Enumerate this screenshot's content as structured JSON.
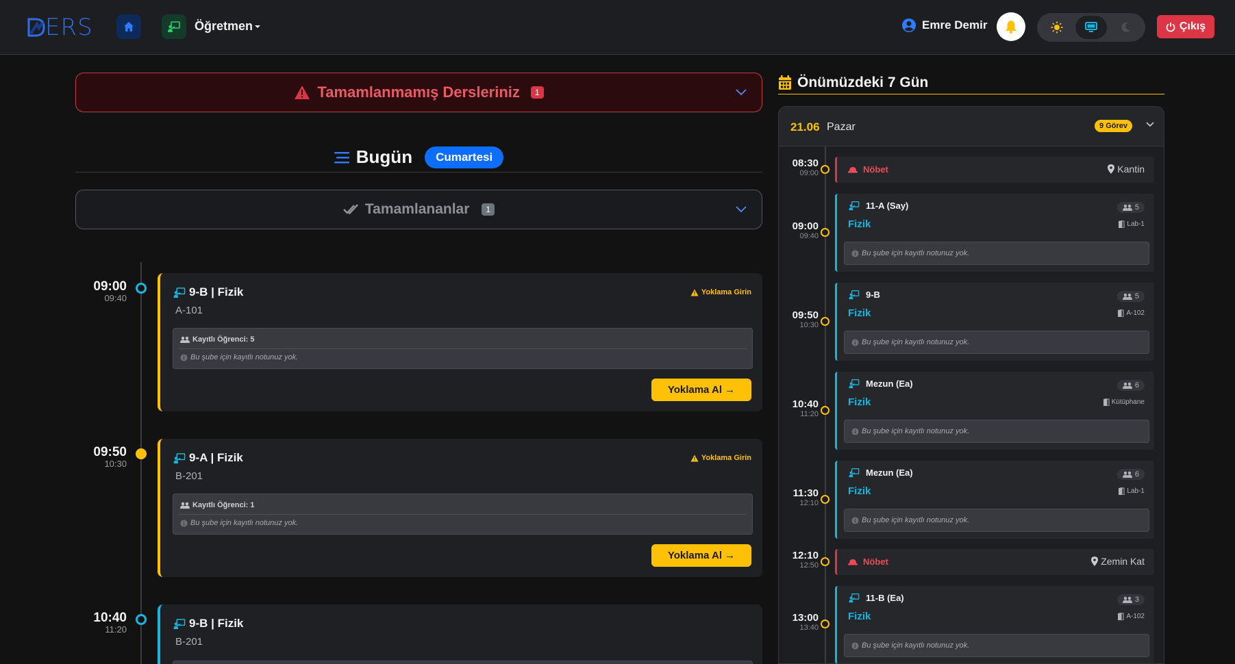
{
  "navbar": {
    "logo_text": "ERS",
    "role_label": "Öğretmen",
    "user_name": "Emre Demir",
    "logout_label": "Çıkış",
    "colors": {
      "bg": "#1d1e21",
      "brand": "#2e6ee6",
      "danger": "#dc3545"
    },
    "icons": [
      "home-icon",
      "teacher-icon",
      "user-circle-icon",
      "bell-icon",
      "sun-icon",
      "monitor-icon",
      "moon-icon",
      "power-icon"
    ]
  },
  "incomplete": {
    "title": "Tamamlanmamış Dersleriniz",
    "count": "1"
  },
  "today": {
    "title": "Bugün",
    "day": "Cumartesi"
  },
  "completed": {
    "title": "Tamamlananlar",
    "count": "1"
  },
  "lessons": [
    {
      "start": "09:00",
      "end": "09:40",
      "title": "9-B | Fizik",
      "room": "A-101",
      "warning": "Yoklama Girin",
      "students": "Kayıtlı Öğrenci: 5",
      "note": "Bu şube için kayıtlı notunuz yok.",
      "button": "Yoklama Al →"
    },
    {
      "start": "09:50",
      "end": "10:30",
      "title": "9-A | Fizik",
      "room": "B-201",
      "warning": "Yoklama Girin",
      "students": "Kayıtlı Öğrenci: 1",
      "note": "Bu şube için kayıtlı notunuz yok.",
      "button": "Yoklama Al →"
    },
    {
      "start": "10:40",
      "end": "11:20",
      "title": "9-B | Fizik",
      "room": "B-201"
    }
  ],
  "upcoming": {
    "title": "Önümüzdeki 7 Gün",
    "date": "21.06",
    "day": "Pazar",
    "task_badge": "9 Görev",
    "items": [
      {
        "start": "08:30",
        "end": "09:00",
        "type": "duty",
        "label": "Nöbet",
        "location": "Kantin"
      },
      {
        "start": "09:00",
        "end": "09:40",
        "type": "lesson",
        "class": "11-A (Say)",
        "subject": "Fizik",
        "count": "5",
        "room": "Lab-1",
        "note": "Bu şube için kayıtlı notunuz yok."
      },
      {
        "start": "09:50",
        "end": "10:30",
        "type": "lesson",
        "class": "9-B",
        "subject": "Fizik",
        "count": "5",
        "room": "A-102",
        "note": "Bu şube için kayıtlı notunuz yok."
      },
      {
        "start": "10:40",
        "end": "11:20",
        "type": "lesson",
        "class": "Mezun (Ea)",
        "subject": "Fizik",
        "count": "6",
        "room": "Kütüphane",
        "note": "Bu şube için kayıtlı notunuz yok."
      },
      {
        "start": "11:30",
        "end": "12:10",
        "type": "lesson",
        "class": "Mezun (Ea)",
        "subject": "Fizik",
        "count": "6",
        "room": "Lab-1",
        "note": "Bu şube için kayıtlı notunuz yok."
      },
      {
        "start": "12:10",
        "end": "12:50",
        "type": "duty",
        "label": "Nöbet",
        "location": "Zemin Kat"
      },
      {
        "start": "13:00",
        "end": "13:40",
        "type": "lesson",
        "class": "11-B (Ea)",
        "subject": "Fizik",
        "count": "3",
        "room": "A-102",
        "note": "Bu şube için kayıtlı notunuz yok."
      }
    ]
  }
}
